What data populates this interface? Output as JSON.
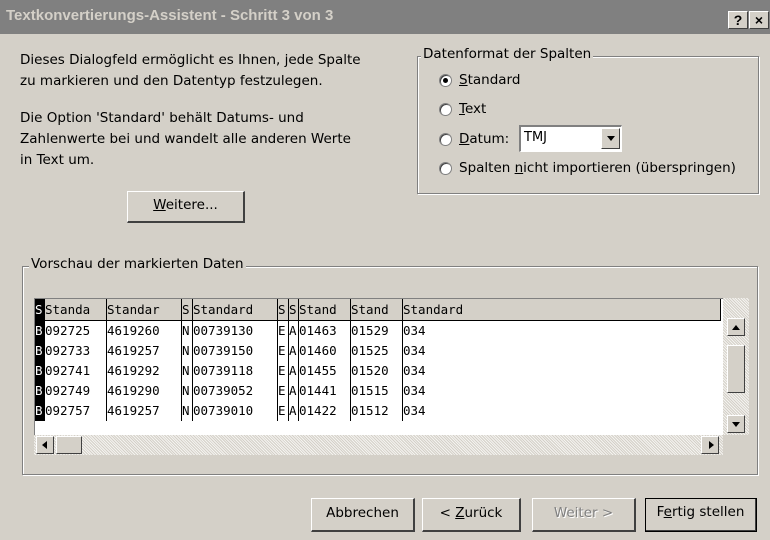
{
  "window": {
    "title": "Textkonvertierungs-Assistent - Schritt 3 von 3",
    "help_label": "?",
    "close_label": "×"
  },
  "description": {
    "line1": "Dieses Dialogfeld ermöglicht es Ihnen, jede Spalte",
    "line2": "zu markieren und den Datentyp festzulegen.",
    "line3": "Die Option 'Standard' behält Datums- und",
    "line4": "Zahlenwerte bei und wandelt alle anderen Werte",
    "line5": "in Text um."
  },
  "advanced_button": {
    "label_u": "W",
    "label_rest": "eitere..."
  },
  "format_group": {
    "title": "Datenformat der Spalten",
    "options": [
      {
        "label_u": "S",
        "label_rest": "tandard",
        "selected": true
      },
      {
        "label_u": "T",
        "label_rest": "ext",
        "selected": false
      },
      {
        "label_u": "D",
        "label_rest": "atum:",
        "selected": false
      },
      {
        "label_pre": "Spalten ",
        "label_u": "n",
        "label_rest": "icht importieren (überspringen)",
        "selected": false
      }
    ],
    "date_format": "TMJ"
  },
  "preview_group": {
    "title": "Vorschau der markierten Daten",
    "headers": [
      "S",
      "Standa",
      "Standar",
      "S",
      "Standard",
      "S",
      "S",
      "Stand",
      "Stand",
      "Standard"
    ],
    "rows": [
      [
        "B",
        "092725",
        "4619260",
        "N",
        "00739130",
        "E",
        "A",
        "01463",
        "01529",
        "034"
      ],
      [
        "B",
        "092733",
        "4619257",
        "N",
        "00739150",
        "E",
        "A",
        "01460",
        "01525",
        "034"
      ],
      [
        "B",
        "092741",
        "4619292",
        "N",
        "00739118",
        "E",
        "A",
        "01455",
        "01520",
        "034"
      ],
      [
        "B",
        "092749",
        "4619290",
        "N",
        "00739052",
        "E",
        "A",
        "01441",
        "01515",
        "034"
      ],
      [
        "B",
        "092757",
        "4619257",
        "N",
        "00739010",
        "E",
        "A",
        "01422",
        "01512",
        "034"
      ]
    ]
  },
  "buttons": {
    "cancel": "Abbrechen",
    "back_pre": "< ",
    "back_u": "Z",
    "back_rest": "urück",
    "next": "Weiter >",
    "finish_pre": "F",
    "finish_u": "e",
    "finish_rest": "rtig stellen"
  }
}
